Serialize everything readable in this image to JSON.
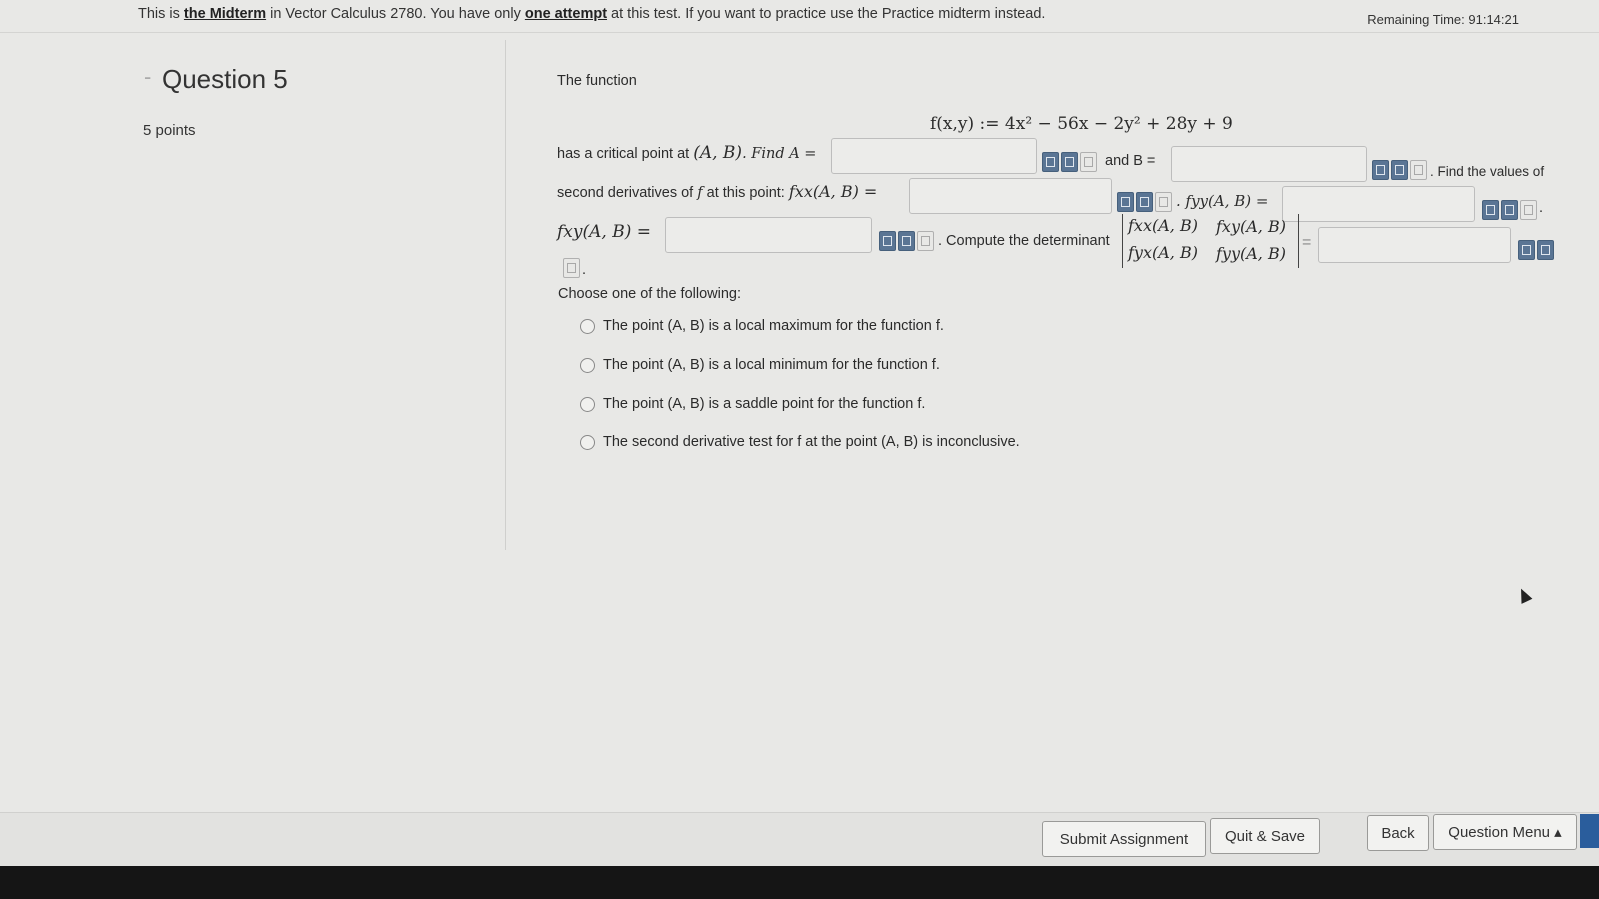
{
  "banner": {
    "prefix": "This is ",
    "midterm_link": "the Midterm",
    "middle": " in Vector Calculus 2780. You have only ",
    "attempt_link": "one attempt",
    "suffix": " at this test. If you want to practice use the Practice midterm instead."
  },
  "timer": "Remaining Time:  91:14:21",
  "question": {
    "dash": "-",
    "title": "Question 5",
    "points": "5 points"
  },
  "body": {
    "intro": "The function",
    "function_expr": "f(x,y) := 4x² − 56x − 2y² + 28y + 9",
    "critical_text": "has a critical point at ",
    "ab_point": "(A, B)",
    "find_a": ". Find A =",
    "and_b": "and B =",
    "find_values": ". Find the values of",
    "second_derivs": "second derivatives of ",
    "f_letter": "f",
    "at_point": " at this point: ",
    "fxx_label": "fxx(A, B) =",
    "fyy_label": ". fyy(A, B) =",
    "fxy_label": "fxy(A, B) =",
    "compute_det": ". Compute the determinant",
    "det_fxx": "fxx(A, B)",
    "det_fxy": "fxy(A, B)",
    "det_fyx": "fyx(A, B)",
    "det_fyy": "fyy(A, B)",
    "equals": "=",
    "period": ".",
    "choose": "Choose one of the following:"
  },
  "options": [
    "The point (A, B) is a local maximum for the function f.",
    "The point (A, B) is a local minimum for the function f.",
    "The point (A, B) is a saddle point for the function f.",
    "The second derivative test for f at the point (A, B) is inconclusive."
  ],
  "buttons": {
    "submit": "Submit Assignment",
    "quit": "Quit & Save",
    "back": "Back",
    "menu": "Question Menu ▴"
  },
  "colors": {
    "accent": "#2a5d9c",
    "tool": "#5a7594"
  }
}
